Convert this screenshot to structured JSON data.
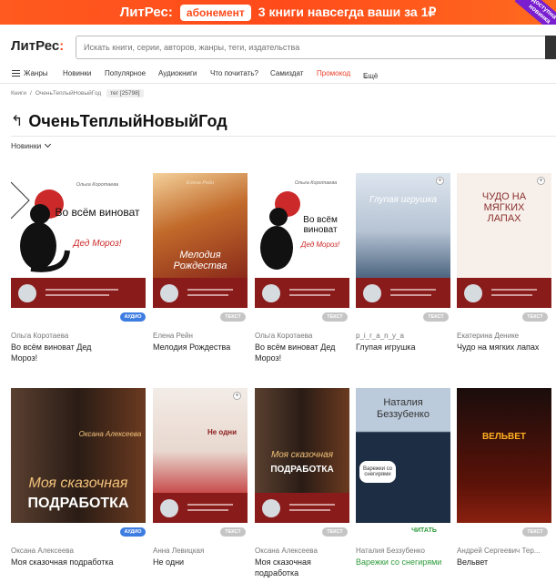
{
  "promo": {
    "logo": "ЛитРес:",
    "badge": "абонемент",
    "text": "3 книги навсегда ваши за 1₽",
    "corner": "доступна новинка"
  },
  "header": {
    "logo": "ЛитРес",
    "search_placeholder": "Искать книги, серии, авторов, жанры, теги, издательства"
  },
  "nav": {
    "genres": "Жанры",
    "items": [
      "Новинки",
      "Популярное",
      "Аудиокниги",
      "Что почитать?",
      "Самиздат",
      "Промокод",
      "Ещё"
    ]
  },
  "breadcrumb": {
    "items": [
      "Книги",
      "ОченьТеплыйНовыйГод"
    ],
    "tag": "тег [25798]"
  },
  "page": {
    "title": "ОченьТеплыйНовыйГод",
    "sort": "Новинки"
  },
  "books": [
    {
      "author": "Ольга Коротаева",
      "title": "Во всём виноват Дед Мороз!",
      "badge": "АУДИО",
      "cover_title": "Во всём виноват",
      "cover_sub": "Дед Мороз!",
      "cover_author": "Ольга Коротаева"
    },
    {
      "author": "Елена Рейн",
      "title": "Мелодия Рождества",
      "badge": "ТЕКСТ",
      "cover_title": "Мелодия Рождества",
      "cover_author": "Елена Рейн"
    },
    {
      "author": "Ольга Коротаева",
      "title": "Во всём виноват Дед Мороз!",
      "badge": "ТЕКСТ",
      "cover_title": "Во всём виноват",
      "cover_sub": "Дед Мороз!",
      "cover_author": "Ольга Коротаева"
    },
    {
      "author": "p_i_r_a_n_y_a",
      "title": "Глупая игрушка",
      "badge": "ТЕКСТ",
      "cover_title": "Глупая игрушка"
    },
    {
      "author": "Екатерина Денике",
      "title": "Чудо на мягких лапах",
      "badge": "ТЕКСТ",
      "cover_title": "ЧУДО НА МЯГКИХ ЛАПАХ"
    },
    {
      "author": "Оксана Алексеева",
      "title": "Моя сказочная подработка",
      "badge": "АУДИО",
      "cover_title": "Моя сказочная",
      "cover_sub": "ПОДРАБОТКА",
      "cover_author": "Оксана Алексеева"
    },
    {
      "author": "Анна Левицкая",
      "title": "Не одни",
      "badge": "ТЕКСТ",
      "cover_title": "Не одни"
    },
    {
      "author": "Оксана Алексеева",
      "title": "Моя сказочная подработка",
      "badge": "ТЕКСТ",
      "cover_title": "Моя сказочная",
      "cover_sub": "ПОДРАБОТКА"
    },
    {
      "author": "Наталия Беззубенко",
      "title": "Варежки со снегирями",
      "badge": "ЧИТАТЬ",
      "cover_title": "Наталия Беззубенко",
      "cover_sub": "Варежки со снегирями"
    },
    {
      "author": "Андрей Сергеевич Тер...",
      "title": "Вельвет",
      "badge": "ТЕКСТ",
      "cover_title": "ВЕЛЬВЕТ"
    }
  ],
  "colors": {
    "brand": "#ff4b1a",
    "promo_link": "#e8402a",
    "audio_badge": "#3d7ce0",
    "read_green": "#2d9a3b"
  }
}
